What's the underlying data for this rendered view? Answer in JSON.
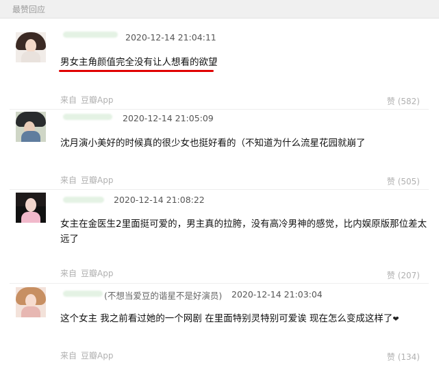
{
  "header": {
    "title": "最赞回应"
  },
  "comments": [
    {
      "timestamp": "2020-12-14 21:04:11",
      "text": "男女主角颜值完全没有让人想看的欲望",
      "source_prefix": "来自",
      "source_app": "豆瓣App",
      "likes": "赞 (582)"
    },
    {
      "timestamp": "2020-12-14 21:05:09",
      "text": "沈月演小美好的时候真的很少女也挺好看的（不知道为什么流星花园就崩了",
      "source_prefix": "来自",
      "source_app": "豆瓣App",
      "likes": "赞 (505)"
    },
    {
      "timestamp": "2020-12-14 21:08:22",
      "text_line1": "女主在金医生2里面挺可爱的，男主真的拉胯，没有高冷男神的感觉，比内娱原版那位差太",
      "text_line2": "远了",
      "source_prefix": "来自",
      "source_app": "豆瓣App",
      "likes": "赞 (207)"
    },
    {
      "note": "(不想当爱豆的谐星不是好演员)",
      "timestamp": "2020-12-14 21:03:04",
      "text": "这个女主 我之前看过她的一个网剧 在里面特别灵特别可爱诶 现在怎么变成这样了",
      "heart": "❤",
      "source_prefix": "来自",
      "source_app": "豆瓣App",
      "likes": "赞 (134)"
    }
  ],
  "colors": {
    "underline": "#e00000",
    "username_blur": "#e4f2e4"
  }
}
